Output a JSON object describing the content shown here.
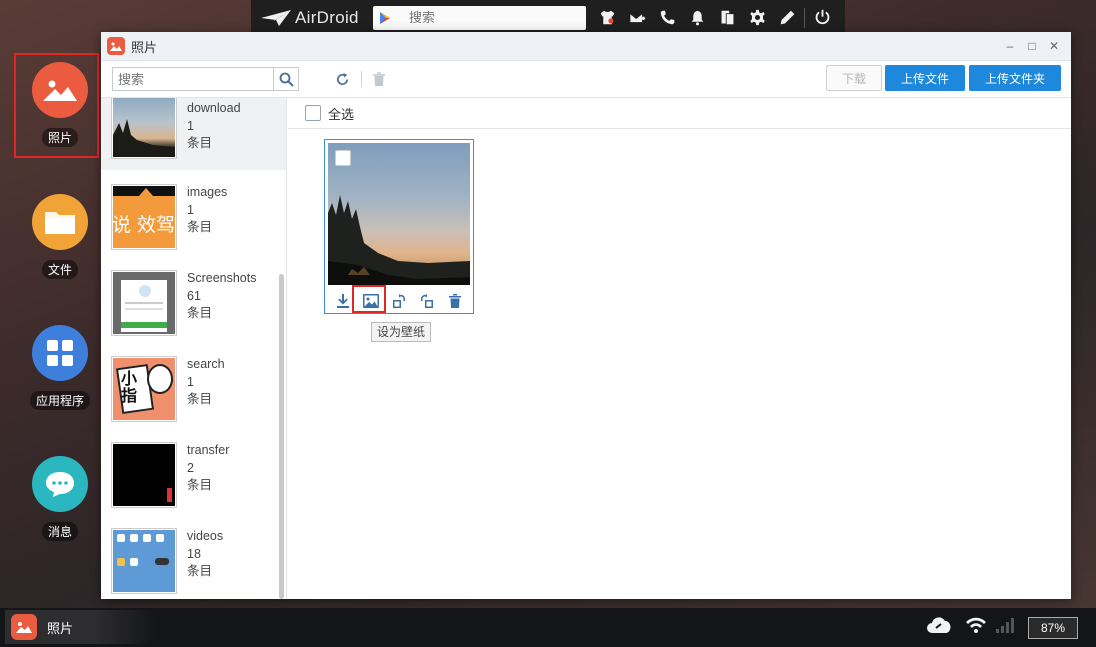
{
  "topbar": {
    "brand": "AirDroid",
    "search_placeholder": "搜索",
    "icons": [
      "shirt-icon",
      "mail-plus-icon",
      "phone-icon",
      "bell-icon",
      "copy-icon",
      "gear-icon",
      "pen-icon",
      "power-icon"
    ]
  },
  "dock": {
    "items": [
      {
        "label": "照片",
        "icon": "photos-icon",
        "color": "#ea5b3f"
      },
      {
        "label": "文件",
        "icon": "folder-icon",
        "color": "#f0a437"
      },
      {
        "label": "应用程序",
        "icon": "apps-icon",
        "color": "#3f7fdc"
      },
      {
        "label": "消息",
        "icon": "message-icon",
        "color": "#2bb7c0"
      }
    ]
  },
  "window": {
    "title": "照片",
    "search_placeholder": "搜索",
    "buttons": {
      "download": "下载",
      "upload_file": "上传文件",
      "upload_folder": "上传文件夹"
    },
    "select_all": "全选",
    "albums": [
      {
        "name": "download",
        "count": "1",
        "unit": "条目"
      },
      {
        "name": "images",
        "count": "1",
        "unit": "条目"
      },
      {
        "name": "Screenshots",
        "count": "61",
        "unit": "条目"
      },
      {
        "name": "search",
        "count": "1",
        "unit": "条目"
      },
      {
        "name": "transfer",
        "count": "2",
        "unit": "条目"
      },
      {
        "name": "videos",
        "count": "18",
        "unit": "条目"
      }
    ],
    "images_thumb_text": "说 效驾",
    "search_thumb_text": "小指",
    "tooltip": "设为壁纸"
  },
  "taskbar": {
    "app_label": "照片",
    "battery": "87%"
  },
  "colors": {
    "accent": "#1e88dc",
    "highlight": "#e12626",
    "photos_app": "#ea5b3f"
  }
}
